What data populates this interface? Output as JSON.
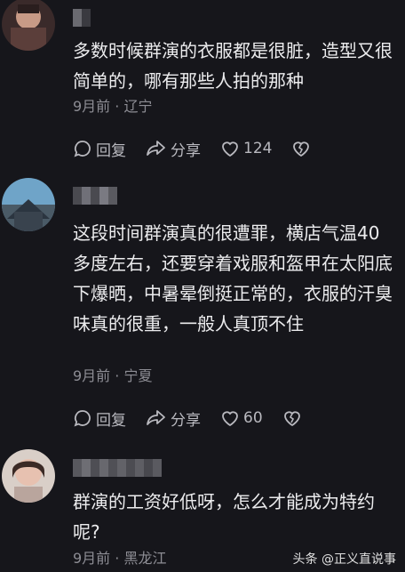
{
  "comments": [
    {
      "text": "多数时候群演的衣服都是很脏，造型又很简单的，哪有那些人拍的那种",
      "time": "9月前",
      "location": "辽宁",
      "reply_label": "回复",
      "share_label": "分享",
      "like_count": "124"
    },
    {
      "text": "这段时间群演真的很遭罪，横店气温40多度左右，还要穿着戏服和盔甲在太阳底下爆晒，中暑晕倒挺正常的，衣服的汗臭味真的很重，一般人真顶不住",
      "time": "9月前",
      "location": "宁夏",
      "reply_label": "回复",
      "share_label": "分享",
      "like_count": "60"
    },
    {
      "text": "群演的工资好低呀，怎么才能成为特约呢?",
      "time": "9月前",
      "location": "黑龙江"
    }
  ],
  "separator": " · ",
  "watermark": "头条 @正义直说事",
  "icons": {
    "reply": "reply-bubble-icon",
    "share": "share-arrow-icon",
    "like": "heart-icon",
    "dislike": "broken-heart-icon"
  }
}
